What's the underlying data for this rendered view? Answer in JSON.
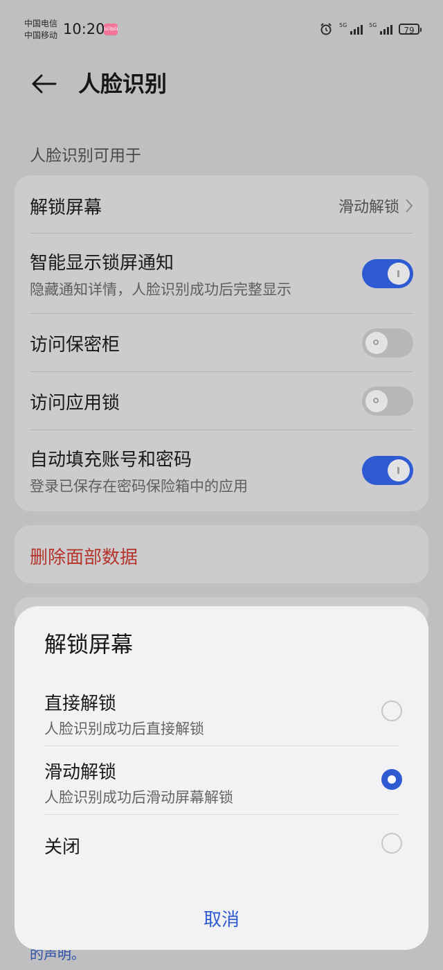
{
  "status_bar": {
    "carrier1": "中国电信",
    "carrier2": "中国移动",
    "time": "10:20",
    "app_badge": "bilibili",
    "network1": "5G",
    "network2": "5G",
    "battery": "79"
  },
  "header": {
    "title": "人脸识别"
  },
  "section_label": "人脸识别可用于",
  "settings": {
    "unlock_screen": {
      "label": "解锁屏幕",
      "value": "滑动解锁"
    },
    "smart_notify": {
      "label": "智能显示锁屏通知",
      "desc": "隐藏通知详情，人脸识别成功后完整显示",
      "on": true
    },
    "safe": {
      "label": "访问保密柜",
      "on": false
    },
    "app_lock": {
      "label": "访问应用锁",
      "on": false
    },
    "autofill": {
      "label": "自动填充账号和密码",
      "desc": "登录已保存在密码保险箱中的应用",
      "on": true
    }
  },
  "delete_label": "删除面部数据",
  "footer_link_fragment": "的声明。",
  "sheet": {
    "title": "解锁屏幕",
    "options": [
      {
        "label": "直接解锁",
        "desc": "人脸识别成功后直接解锁",
        "selected": false
      },
      {
        "label": "滑动解锁",
        "desc": "人脸识别成功后滑动屏幕解锁",
        "selected": true
      },
      {
        "label": "关闭",
        "desc": "",
        "selected": false
      }
    ],
    "cancel": "取消"
  },
  "colors": {
    "accent": "#2f5bd2",
    "danger": "#b5342c"
  }
}
